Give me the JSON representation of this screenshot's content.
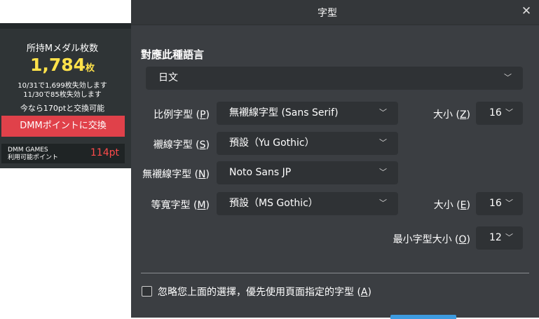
{
  "dmm_panel": {
    "medal_title": "所持Mメダル枚数",
    "medal_count": "1,784",
    "medal_unit": "枚",
    "expiry_lines": [
      "10/31で1,699枚失効します",
      "11/30で85枚失効します"
    ],
    "exchange_note": "今なら170ptと交換可能",
    "exchange_button": "DMMポイントに交換",
    "points_label_line1": "DMM GAMES",
    "points_label_line2": "利用可能ポイント",
    "points_value": "114pt",
    "colors": {
      "count": "#ffe24a",
      "button": "#e0414a",
      "points": "#ff4b4b"
    }
  },
  "font_dialog": {
    "title": "字型",
    "close_icon": "close-icon",
    "language_heading": "對應此種語言",
    "language_value": "日文",
    "rows": {
      "proportional": {
        "label": "比例字型 (",
        "key": "P",
        "label_end": ")",
        "value": "無襯線字型 (Sans Serif)"
      },
      "serif": {
        "label": "襯線字型 (",
        "key": "S",
        "label_end": ")",
        "value": "預設（Yu Gothic）"
      },
      "sans_serif": {
        "label": "無襯線字型 (",
        "key": "N",
        "label_end": ")",
        "value": "Noto Sans JP"
      },
      "monospace": {
        "label": "等寬字型 (",
        "key": "M",
        "label_end": ")",
        "value": "預設（MS Gothic）"
      }
    },
    "size_proportional": {
      "label": "大小 (",
      "key": "Z",
      "label_end": ")",
      "value": "16"
    },
    "size_monospace": {
      "label": "大小 (",
      "key": "E",
      "label_end": ")",
      "value": "16"
    },
    "min_size": {
      "label": "最小字型大小 (",
      "key": "O",
      "label_end": ")",
      "value": "12"
    },
    "override_checkbox": {
      "label": "忽略您上面的選擇，優先使用頁面指定的字型 (",
      "key": "A",
      "label_end": ")",
      "checked": false
    },
    "chevron_icon": "chevron-down-icon",
    "colors": {
      "background": "#3b3e42",
      "field": "#2f3235",
      "accent": "#3d9be0"
    }
  }
}
